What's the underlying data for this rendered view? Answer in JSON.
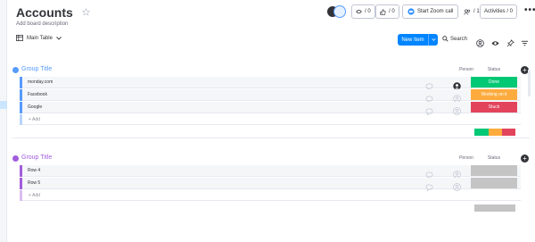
{
  "board": {
    "title": "Accounts",
    "description": "Add board description"
  },
  "header": {
    "activity_seen": "/ 0",
    "activity_likes": "/ 0",
    "zoom_label": "Start Zoom call",
    "members": "/ 1",
    "activities_label": "Activities / 0",
    "more_label": "•••"
  },
  "toolbar": {
    "view_label": "Main Table",
    "new_item_label": "New Item",
    "search_label": "Search"
  },
  "columns": {
    "person": "Person",
    "status": "Status"
  },
  "groups": [
    {
      "title": "Group Title",
      "color": "#579bfc",
      "add_label": "+ Add",
      "rows": [
        {
          "name": "monday.com",
          "status": "Done",
          "status_color": "#00c875",
          "person_filled": true
        },
        {
          "name": "Facebook",
          "status": "Working on it",
          "status_color": "#fdab3d",
          "person_filled": false
        },
        {
          "name": "Google",
          "status": "Stuck",
          "status_color": "#e2445c",
          "person_filled": false
        }
      ],
      "summary": [
        {
          "color": "#00c875",
          "fraction": 0.34
        },
        {
          "color": "#fdab3d",
          "fraction": 0.33
        },
        {
          "color": "#e2445c",
          "fraction": 0.33
        }
      ]
    },
    {
      "title": "Group Title",
      "color": "#a25ddc",
      "add_label": "+ Add",
      "rows": [
        {
          "name": "Row 4",
          "status": "",
          "status_color": "#c4c4c4",
          "person_filled": false
        },
        {
          "name": "Row 5",
          "status": "",
          "status_color": "#c4c4c4",
          "person_filled": false
        }
      ],
      "summary": [
        {
          "color": "#c4c4c4",
          "fraction": 1.0
        }
      ]
    }
  ]
}
